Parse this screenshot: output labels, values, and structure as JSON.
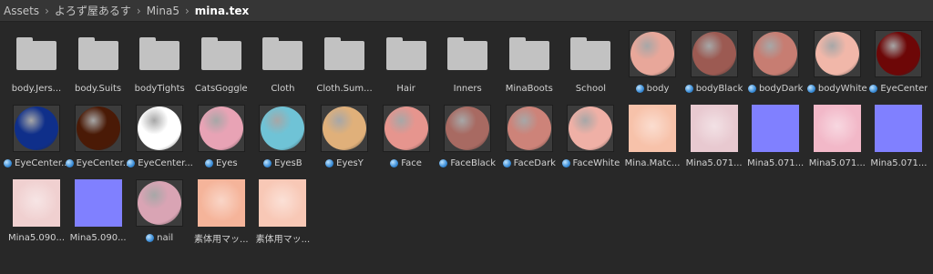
{
  "breadcrumb": [
    "Assets",
    "よろず屋あるす",
    "Mina5",
    "mina.tex"
  ],
  "row1": [
    {
      "type": "folder",
      "label": "body.Jers..."
    },
    {
      "type": "folder",
      "label": "body.Suits"
    },
    {
      "type": "folder",
      "label": "bodyTights"
    },
    {
      "type": "folder",
      "label": "CatsGoggle"
    },
    {
      "type": "folder",
      "label": "Cloth"
    },
    {
      "type": "folder",
      "label": "Cloth.Sum..."
    },
    {
      "type": "folder",
      "label": "Hair"
    },
    {
      "type": "folder",
      "label": "Inners"
    },
    {
      "type": "folder",
      "label": "MinaBoots"
    },
    {
      "type": "folder",
      "label": "School"
    },
    {
      "type": "material",
      "label": "body",
      "color": "#e8a79a"
    },
    {
      "type": "material",
      "label": "bodyBlack",
      "color": "#9c5a52"
    },
    {
      "type": "material",
      "label": "bodyDark",
      "color": "#c77d72"
    },
    {
      "type": "material",
      "label": "bodyWhite",
      "color": "#f1b7a9"
    },
    {
      "type": "material",
      "label": "EyeCenter",
      "color": "#6d0707"
    }
  ],
  "row2": [
    {
      "type": "material",
      "label": "EyeCenter...",
      "color": "#0f2f8a"
    },
    {
      "type": "material",
      "label": "EyeCenter...",
      "color": "#4a1a06"
    },
    {
      "type": "material",
      "label": "EyeCenter...",
      "color": "#ffffff"
    },
    {
      "type": "material",
      "label": "Eyes",
      "color": "#e8a3b5"
    },
    {
      "type": "material",
      "label": "EyesB",
      "color": "#6fc3d6"
    },
    {
      "type": "material",
      "label": "EyesY",
      "color": "#e0b07a"
    },
    {
      "type": "material",
      "label": "Face",
      "color": "#e6958e"
    },
    {
      "type": "material",
      "label": "FaceBlack",
      "color": "#a86a62"
    },
    {
      "type": "material",
      "label": "FaceDark",
      "color": "#cd8379"
    },
    {
      "type": "material",
      "label": "FaceWhite",
      "color": "#efb0a6"
    },
    {
      "type": "texture",
      "label": "Mina.Matc...",
      "color": "#f7c2aa"
    },
    {
      "type": "texture",
      "label": "Mina5.071...",
      "color": "#e8c9d0"
    },
    {
      "type": "texture",
      "label": "Mina5.071...",
      "color": "#8080ff"
    },
    {
      "type": "texture",
      "label": "Mina5.071...",
      "color": "#f2b8c8"
    },
    {
      "type": "texture",
      "label": "Mina5.071...",
      "color": "#8080ff"
    }
  ],
  "row3": [
    {
      "type": "texture",
      "label": "Mina5.090...",
      "color": "#f0d0d0"
    },
    {
      "type": "texture",
      "label": "Mina5.090...",
      "color": "#8080ff"
    },
    {
      "type": "material",
      "label": "nail",
      "color": "#d9a4b4"
    },
    {
      "type": "texture",
      "label": "素体用マッ...",
      "color": "#f5b49a"
    },
    {
      "type": "texture",
      "label": "素体用マッ...",
      "color": "#f8c8b6"
    }
  ]
}
